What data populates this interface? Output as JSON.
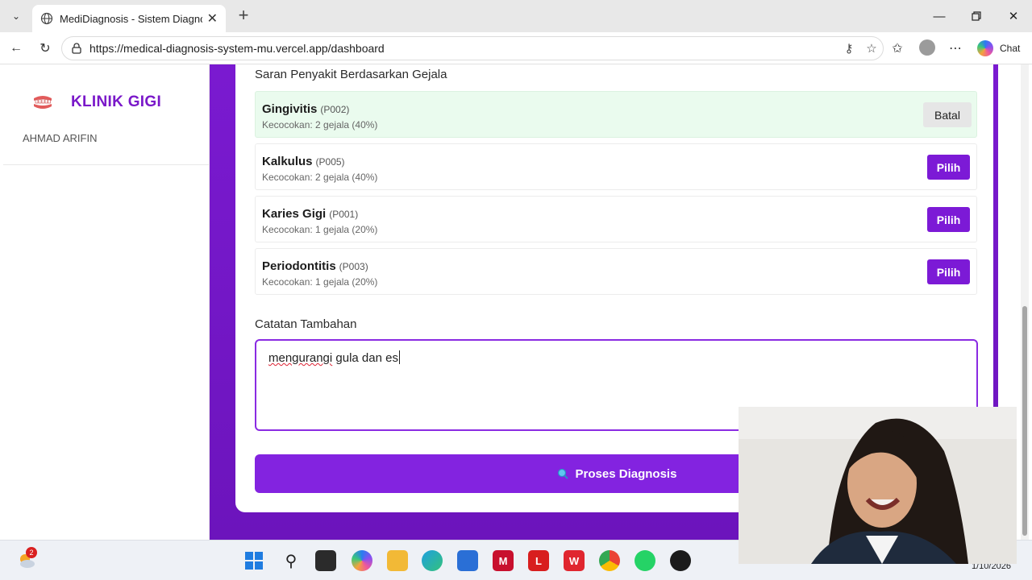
{
  "browser": {
    "tab_title": "MediDiagnosis - Sistem Diagnosis",
    "url": "https://medical-diagnosis-system-mu.vercel.app/dashboard",
    "chat_label": "Chat"
  },
  "sidebar": {
    "brand": "KLINIK GIGI",
    "user": "AHMAD ARIFIN"
  },
  "suggestions": {
    "title": "Saran Penyakit Berdasarkan Gejala",
    "items": [
      {
        "name": "Gingivitis",
        "code": "(P002)",
        "match": "Kecocokan: 2 gejala (40%)",
        "action": "Batal",
        "selected": true
      },
      {
        "name": "Kalkulus",
        "code": "(P005)",
        "match": "Kecocokan: 2 gejala (40%)",
        "action": "Pilih",
        "selected": false
      },
      {
        "name": "Karies Gigi",
        "code": "(P001)",
        "match": "Kecocokan: 1 gejala (20%)",
        "action": "Pilih",
        "selected": false
      },
      {
        "name": "Periodontitis",
        "code": "(P003)",
        "match": "Kecocokan: 1 gejala (20%)",
        "action": "Pilih",
        "selected": false
      }
    ]
  },
  "notes": {
    "label": "Catatan Tambahan",
    "value_first": "mengurangi",
    "value_rest": " gula dan es"
  },
  "process_button": "Proses Diagnosis",
  "taskbar": {
    "notification_count": "2",
    "date": "1/10/2026"
  },
  "colors": {
    "accent": "#7c1ad6",
    "selected_bg": "#eafbee"
  }
}
